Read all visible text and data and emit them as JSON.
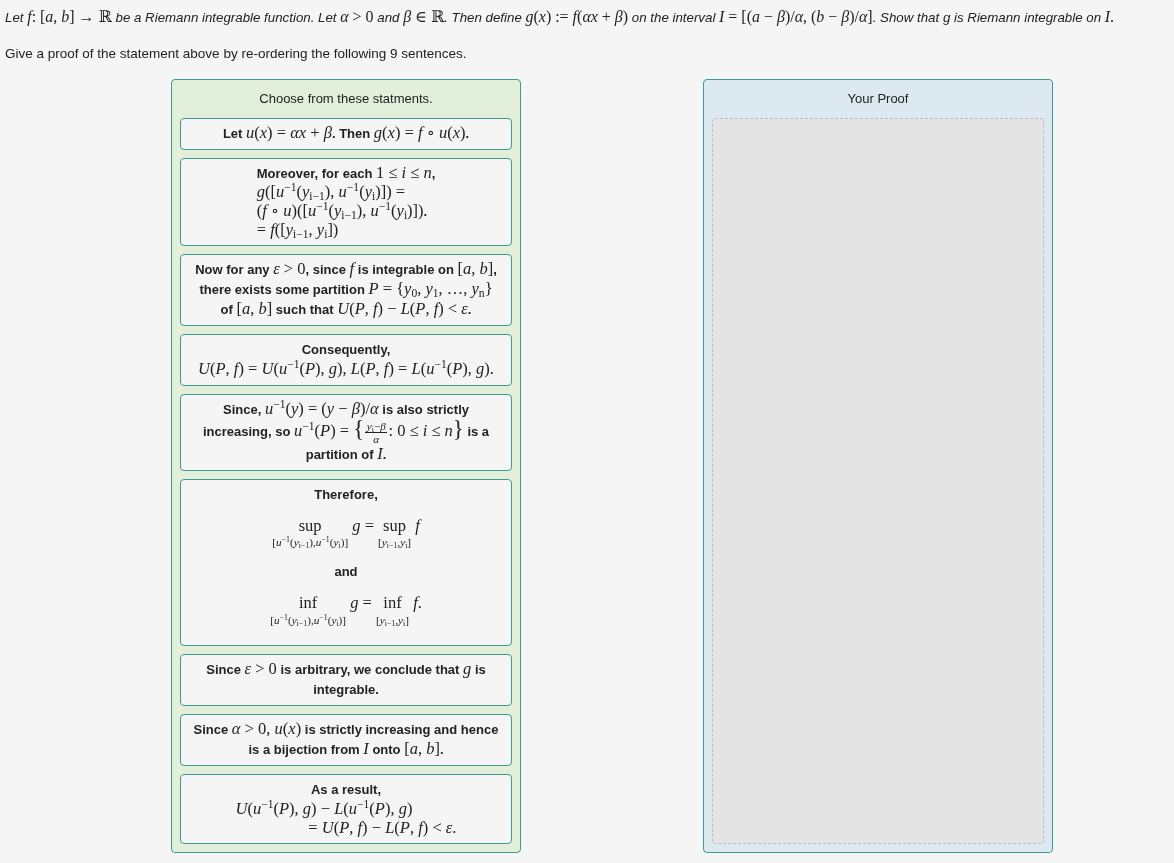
{
  "problem": {
    "statement": [
      {
        "kind": "text",
        "text": "Let "
      },
      {
        "kind": "math",
        "text": "*f*: [*a*, *b*] → ℝ"
      },
      {
        "kind": "text",
        "text": " be a Riemann integrable function. Let "
      },
      {
        "kind": "math",
        "text": "*α* > 0"
      },
      {
        "kind": "text",
        "text": " and "
      },
      {
        "kind": "math",
        "text": "*β* ∈ ℝ"
      },
      {
        "kind": "text",
        "text": ". Then define "
      },
      {
        "kind": "math",
        "text": "*g*(*x*) := *f*(*αx* + *β*)"
      },
      {
        "kind": "text",
        "text": " on the interval "
      },
      {
        "kind": "math",
        "text": "*I* = [(*a* − *β*)/*α*, (*b* − *β*)/*α*]"
      },
      {
        "kind": "text",
        "text": ". Show that g is Riemann integrable on "
      },
      {
        "kind": "math",
        "text": "*I*."
      }
    ],
    "instruction": "Give a proof of the statement above by re-ordering the following 9 sentences."
  },
  "statement_bank": {
    "title": "Choose from these statments.",
    "cards": [
      {
        "lines": [
          {
            "kind": "para",
            "segments": [
              {
                "kind": "text",
                "text": "Let "
              },
              {
                "kind": "math",
                "text": "*u*(*x*) = *αx* + *β*"
              },
              {
                "kind": "text",
                "text": ". Then "
              },
              {
                "kind": "math",
                "text": "*g*(*x*) = *f* ∘ *u*(*x*)"
              },
              {
                "kind": "text",
                "text": "."
              }
            ]
          }
        ]
      },
      {
        "lines": [
          {
            "kind": "aligned",
            "rows": [
              {
                "kind": "row",
                "segments": [
                  {
                    "kind": "text",
                    "text": "Moreover, for each "
                  },
                  {
                    "kind": "math",
                    "text": "1 ≤ *i* ≤ *n*"
                  },
                  {
                    "kind": "text",
                    "text": ","
                  }
                ]
              },
              {
                "kind": "row",
                "segments": [
                  {
                    "kind": "math",
                    "text": "*g*([*u*$^{−1}$(*y*$_{i−1}$), *u*$^{−1}$(*y*$_{i}$)]) ="
                  }
                ]
              },
              {
                "kind": "row",
                "segments": [
                  {
                    "kind": "math",
                    "text": "(*f* ∘ *u*)([*u*$^{−1}$(*y*$_{i−1}$), *u*$^{−1}$(*y*$_{i}$)])"
                  },
                  {
                    "kind": "text",
                    "text": "."
                  }
                ]
              },
              {
                "kind": "row",
                "segments": [
                  {
                    "kind": "math",
                    "text": "= *f*([*y*$_{i−1}$, *y*$_{i}$])"
                  }
                ]
              }
            ]
          }
        ]
      },
      {
        "lines": [
          {
            "kind": "para",
            "segments": [
              {
                "kind": "text",
                "text": "Now for any "
              },
              {
                "kind": "math",
                "text": "*ε* > 0"
              },
              {
                "kind": "text",
                "text": ", since "
              },
              {
                "kind": "math",
                "text": "*f*"
              },
              {
                "kind": "text",
                "text": " is integrable on "
              },
              {
                "kind": "math",
                "text": "[*a*, *b*]"
              },
              {
                "kind": "text",
                "text": ","
              }
            ]
          },
          {
            "kind": "para",
            "segments": [
              {
                "kind": "text",
                "text": "there exists some partition "
              },
              {
                "kind": "math",
                "text": "*P* = {*y*$_{0}$, *y*$_{1}$, …, *y*$_{n}$}"
              }
            ]
          },
          {
            "kind": "para",
            "segments": [
              {
                "kind": "text",
                "text": "of "
              },
              {
                "kind": "math",
                "text": "[*a*, *b*]"
              },
              {
                "kind": "text",
                "text": " such that "
              },
              {
                "kind": "math",
                "text": "*U*(*P*, *f*) − *L*(*P*, *f*) < *ε*"
              },
              {
                "kind": "text",
                "text": "."
              }
            ]
          }
        ]
      },
      {
        "lines": [
          {
            "kind": "para",
            "segments": [
              {
                "kind": "text",
                "text": "Consequently,"
              }
            ]
          },
          {
            "kind": "para",
            "segments": [
              {
                "kind": "math",
                "text": "*U*(*P*, *f*) = *U*(*u*$^{−1}$(*P*), *g*), *L*(*P*, *f*) = *L*(*u*$^{−1}$(*P*), *g*)."
              }
            ]
          }
        ]
      },
      {
        "lines": [
          {
            "kind": "para",
            "segments": [
              {
                "kind": "text",
                "text": "Since, "
              },
              {
                "kind": "math",
                "text": "*u*$^{−1}$(*y*) = (*y* − *β*)/*α*"
              },
              {
                "kind": "text",
                "text": " is also strictly"
              }
            ]
          },
          {
            "kind": "para",
            "segments": [
              {
                "kind": "text",
                "text": "increasing, so "
              },
              {
                "kind": "math",
                "text": "*u*$^{−1}$(*P*) = "
              },
              {
                "kind": "delim",
                "text": "{"
              },
              {
                "kind": "frac",
                "num": "*y*$_{i}$−*β*",
                "den": "*α*"
              },
              {
                "kind": "math",
                "text": ": 0 ≤ *i* ≤ *n*"
              },
              {
                "kind": "delim",
                "text": "}"
              },
              {
                "kind": "text",
                "text": " is a"
              }
            ]
          },
          {
            "kind": "para",
            "segments": [
              {
                "kind": "text",
                "text": "partition of "
              },
              {
                "kind": "math",
                "text": "*I*"
              },
              {
                "kind": "text",
                "text": "."
              }
            ]
          }
        ]
      },
      {
        "lines": [
          {
            "kind": "para",
            "segments": [
              {
                "kind": "text",
                "text": "Therefore,"
              }
            ]
          },
          {
            "kind": "display",
            "segments": [
              {
                "kind": "op",
                "text": "sup",
                "under": "[*u*$^{−1}$(*y*$_{i−1}$),*u*$^{−1}$(*y*$_{i}$)]"
              },
              {
                "kind": "math",
                "text": " *g* = "
              },
              {
                "kind": "op",
                "text": "sup",
                "under": "[*y*$_{i−1}$,*y*$_{i}$]"
              },
              {
                "kind": "math",
                "text": " *f*"
              }
            ]
          },
          {
            "kind": "para",
            "segments": [
              {
                "kind": "text",
                "text": "and"
              }
            ]
          },
          {
            "kind": "display",
            "segments": [
              {
                "kind": "op",
                "text": "inf",
                "under": "[*u*$^{−1}$(*y*$_{i−1}$),*u*$^{−1}$(*y*$_{i}$)]"
              },
              {
                "kind": "math",
                "text": " *g* = "
              },
              {
                "kind": "op",
                "text": "inf",
                "under": "[*y*$_{i−1}$,*y*$_{i}$]"
              },
              {
                "kind": "math",
                "text": " *f*."
              }
            ]
          }
        ]
      },
      {
        "lines": [
          {
            "kind": "para",
            "segments": [
              {
                "kind": "text",
                "text": "Since "
              },
              {
                "kind": "math",
                "text": "*ε* > 0"
              },
              {
                "kind": "text",
                "text": " is arbitrary, we conclude that "
              },
              {
                "kind": "math",
                "text": "*g*"
              },
              {
                "kind": "text",
                "text": " is"
              }
            ]
          },
          {
            "kind": "para",
            "segments": [
              {
                "kind": "text",
                "text": "integrable."
              }
            ]
          }
        ]
      },
      {
        "lines": [
          {
            "kind": "para",
            "segments": [
              {
                "kind": "text",
                "text": "Since "
              },
              {
                "kind": "math",
                "text": "*α* > 0, *u*(*x*)"
              },
              {
                "kind": "text",
                "text": " is strictly increasing and hence"
              }
            ]
          },
          {
            "kind": "para",
            "segments": [
              {
                "kind": "text",
                "text": "is a bijection from "
              },
              {
                "kind": "math",
                "text": "*I*"
              },
              {
                "kind": "text",
                "text": " onto "
              },
              {
                "kind": "math",
                "text": "[*a*, *b*]"
              },
              {
                "kind": "text",
                "text": "."
              }
            ]
          }
        ]
      },
      {
        "lines": [
          {
            "kind": "para",
            "segments": [
              {
                "kind": "text",
                "text": "As a result,"
              }
            ]
          },
          {
            "kind": "aligned",
            "rows": [
              {
                "kind": "row",
                "segments": [
                  {
                    "kind": "math",
                    "text": "*U*(*u*$^{−1}$(*P*), *g*) − *L*(*u*$^{−1}$(*P*), *g*)"
                  }
                ]
              },
              {
                "kind": "continued",
                "segments": [
                  {
                    "kind": "math",
                    "text": "= *U*(*P*, *f*) − *L*(*P*, *f*) < *ε*."
                  }
                ]
              }
            ]
          }
        ]
      }
    ]
  },
  "proof": {
    "title": "Your Proof"
  }
}
